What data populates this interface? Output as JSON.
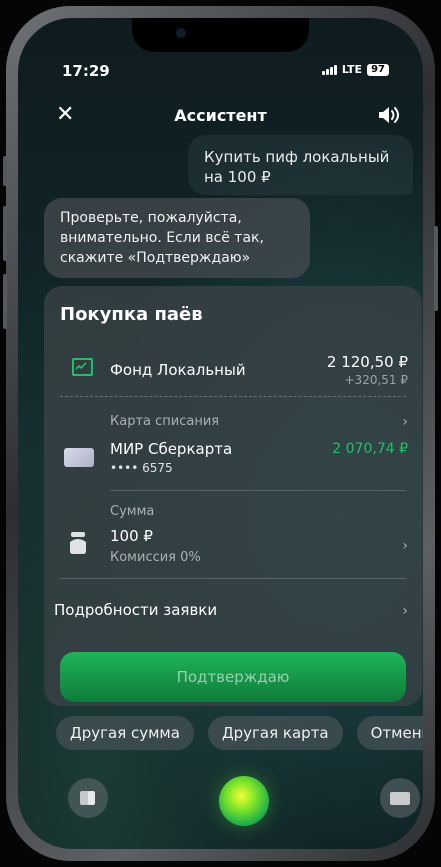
{
  "status": {
    "time": "17:29",
    "network": "LTE",
    "battery": "97"
  },
  "header": {
    "title": "Ассистент"
  },
  "messages": {
    "user": "Купить пиф локальный на 100 ₽",
    "assistant": "Проверьте, пожалуйста, внимательно. Если всё так, скажите «Подтверждаю»"
  },
  "card": {
    "title": "Покупка паёв",
    "fund": {
      "name": "Фонд Локальный",
      "amount": "2 120,50 ₽",
      "delta": "+320,51 ₽"
    },
    "payment": {
      "label": "Карта списания",
      "name": "МИР Сберкарта",
      "number": "•••• 6575",
      "balance": "2 070,74 ₽"
    },
    "sum": {
      "label": "Сумма",
      "value": "100 ₽",
      "fee": "Комиссия 0%"
    },
    "details_label": "Подробности заявки",
    "confirm_label": "Подтверждаю"
  },
  "chips": [
    "Другая сумма",
    "Другая карта",
    "Отменить"
  ],
  "colors": {
    "accent_green": "#21c063",
    "button_green": "#1a9e4b"
  }
}
